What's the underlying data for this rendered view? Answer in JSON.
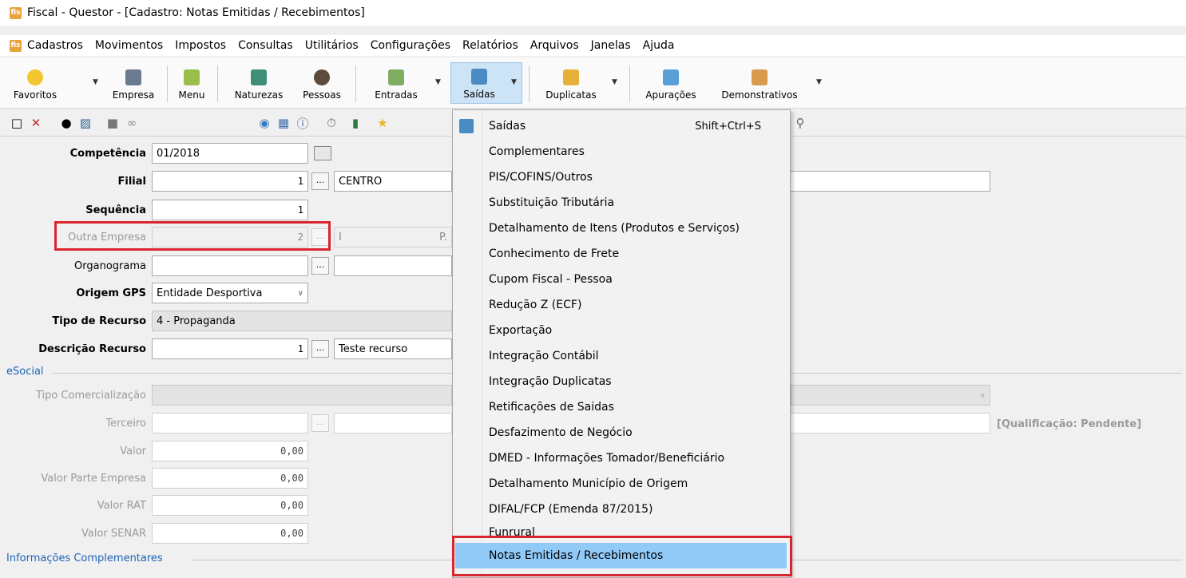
{
  "window": {
    "title": "Fiscal - Questor - [Cadastro: Notas Emitidas / Recebimentos]",
    "app_icon_text": "fis"
  },
  "menubar": [
    "Cadastros",
    "Movimentos",
    "Impostos",
    "Consultas",
    "Utilitários",
    "Configurações",
    "Relatórios",
    "Arquivos",
    "Janelas",
    "Ajuda"
  ],
  "ribbon": {
    "favoritos": "Favoritos",
    "empresa": "Empresa",
    "menu": "Menu",
    "naturezas": "Naturezas",
    "pessoas": "Pessoas",
    "entradas": "Entradas",
    "saidas": "Saídas",
    "duplicatas": "Duplicatas",
    "apuracoes": "Apurações",
    "demonstrativos": "Demonstrativos"
  },
  "form": {
    "competencia": {
      "label": "Competência",
      "value": "01/2018"
    },
    "filial": {
      "label": "Filial",
      "value": "1",
      "desc": "CENTRO"
    },
    "sequencia": {
      "label": "Sequência",
      "value": "1"
    },
    "outra_empresa": {
      "label": "Outra Empresa",
      "value": "2",
      "desc_a": "I",
      "desc_b": "P."
    },
    "organograma": {
      "label": "Organograma",
      "value": ""
    },
    "origem_gps": {
      "label": "Origem GPS",
      "value": "Entidade Desportiva"
    },
    "tipo_recurso": {
      "label": "Tipo de Recurso",
      "value": "4 - Propaganda"
    },
    "descricao_recurso": {
      "label": "Descrição Recurso",
      "value": "1",
      "desc": "Teste recurso"
    },
    "esocial": {
      "group": "eSocial",
      "tipo_comercializacao": "Tipo Comercialização",
      "terceiro": "Terceiro",
      "qualificacao": "[Qualificação: Pendente]",
      "valor": {
        "label": "Valor",
        "value": "0,00"
      },
      "valor_parte_empresa": {
        "label": "Valor Parte Empresa",
        "value": "0,00"
      },
      "valor_rat": {
        "label": "Valor RAT",
        "value": "0,00"
      },
      "valor_senar": {
        "label": "Valor SENAR",
        "value": "0,00"
      }
    },
    "info_compl": "Informações Complementares"
  },
  "dropdown": {
    "items": [
      {
        "label": "Saídas",
        "shortcut": "Shift+Ctrl+S"
      },
      {
        "label": "Complementares"
      },
      {
        "label": "PIS/COFINS/Outros"
      },
      {
        "label": "Substituição Tributária"
      },
      {
        "label": "Detalhamento de Itens (Produtos e Serviços)"
      },
      {
        "label": "Conhecimento de Frete"
      },
      {
        "label": "Cupom Fiscal - Pessoa"
      },
      {
        "label": "Redução Z (ECF)"
      },
      {
        "label": "Exportação"
      },
      {
        "label": "Integração Contábil"
      },
      {
        "label": "Integração Duplicatas"
      },
      {
        "label": "Retificações de Saidas"
      },
      {
        "label": "Desfazimento de Negócio"
      },
      {
        "label": "DMED - Informações Tomador/Beneficiário"
      },
      {
        "label": "Detalhamento Município de Origem"
      },
      {
        "label": "DIFAL/FCP (Emenda 87/2015)"
      },
      {
        "label": "Funrural"
      },
      {
        "label": "Notas Emitidas / Recebimentos"
      }
    ]
  },
  "colors": {
    "highlight": "#91c9f7",
    "annotation_red": "#d9252e",
    "group_blue": "#1c63b7"
  }
}
